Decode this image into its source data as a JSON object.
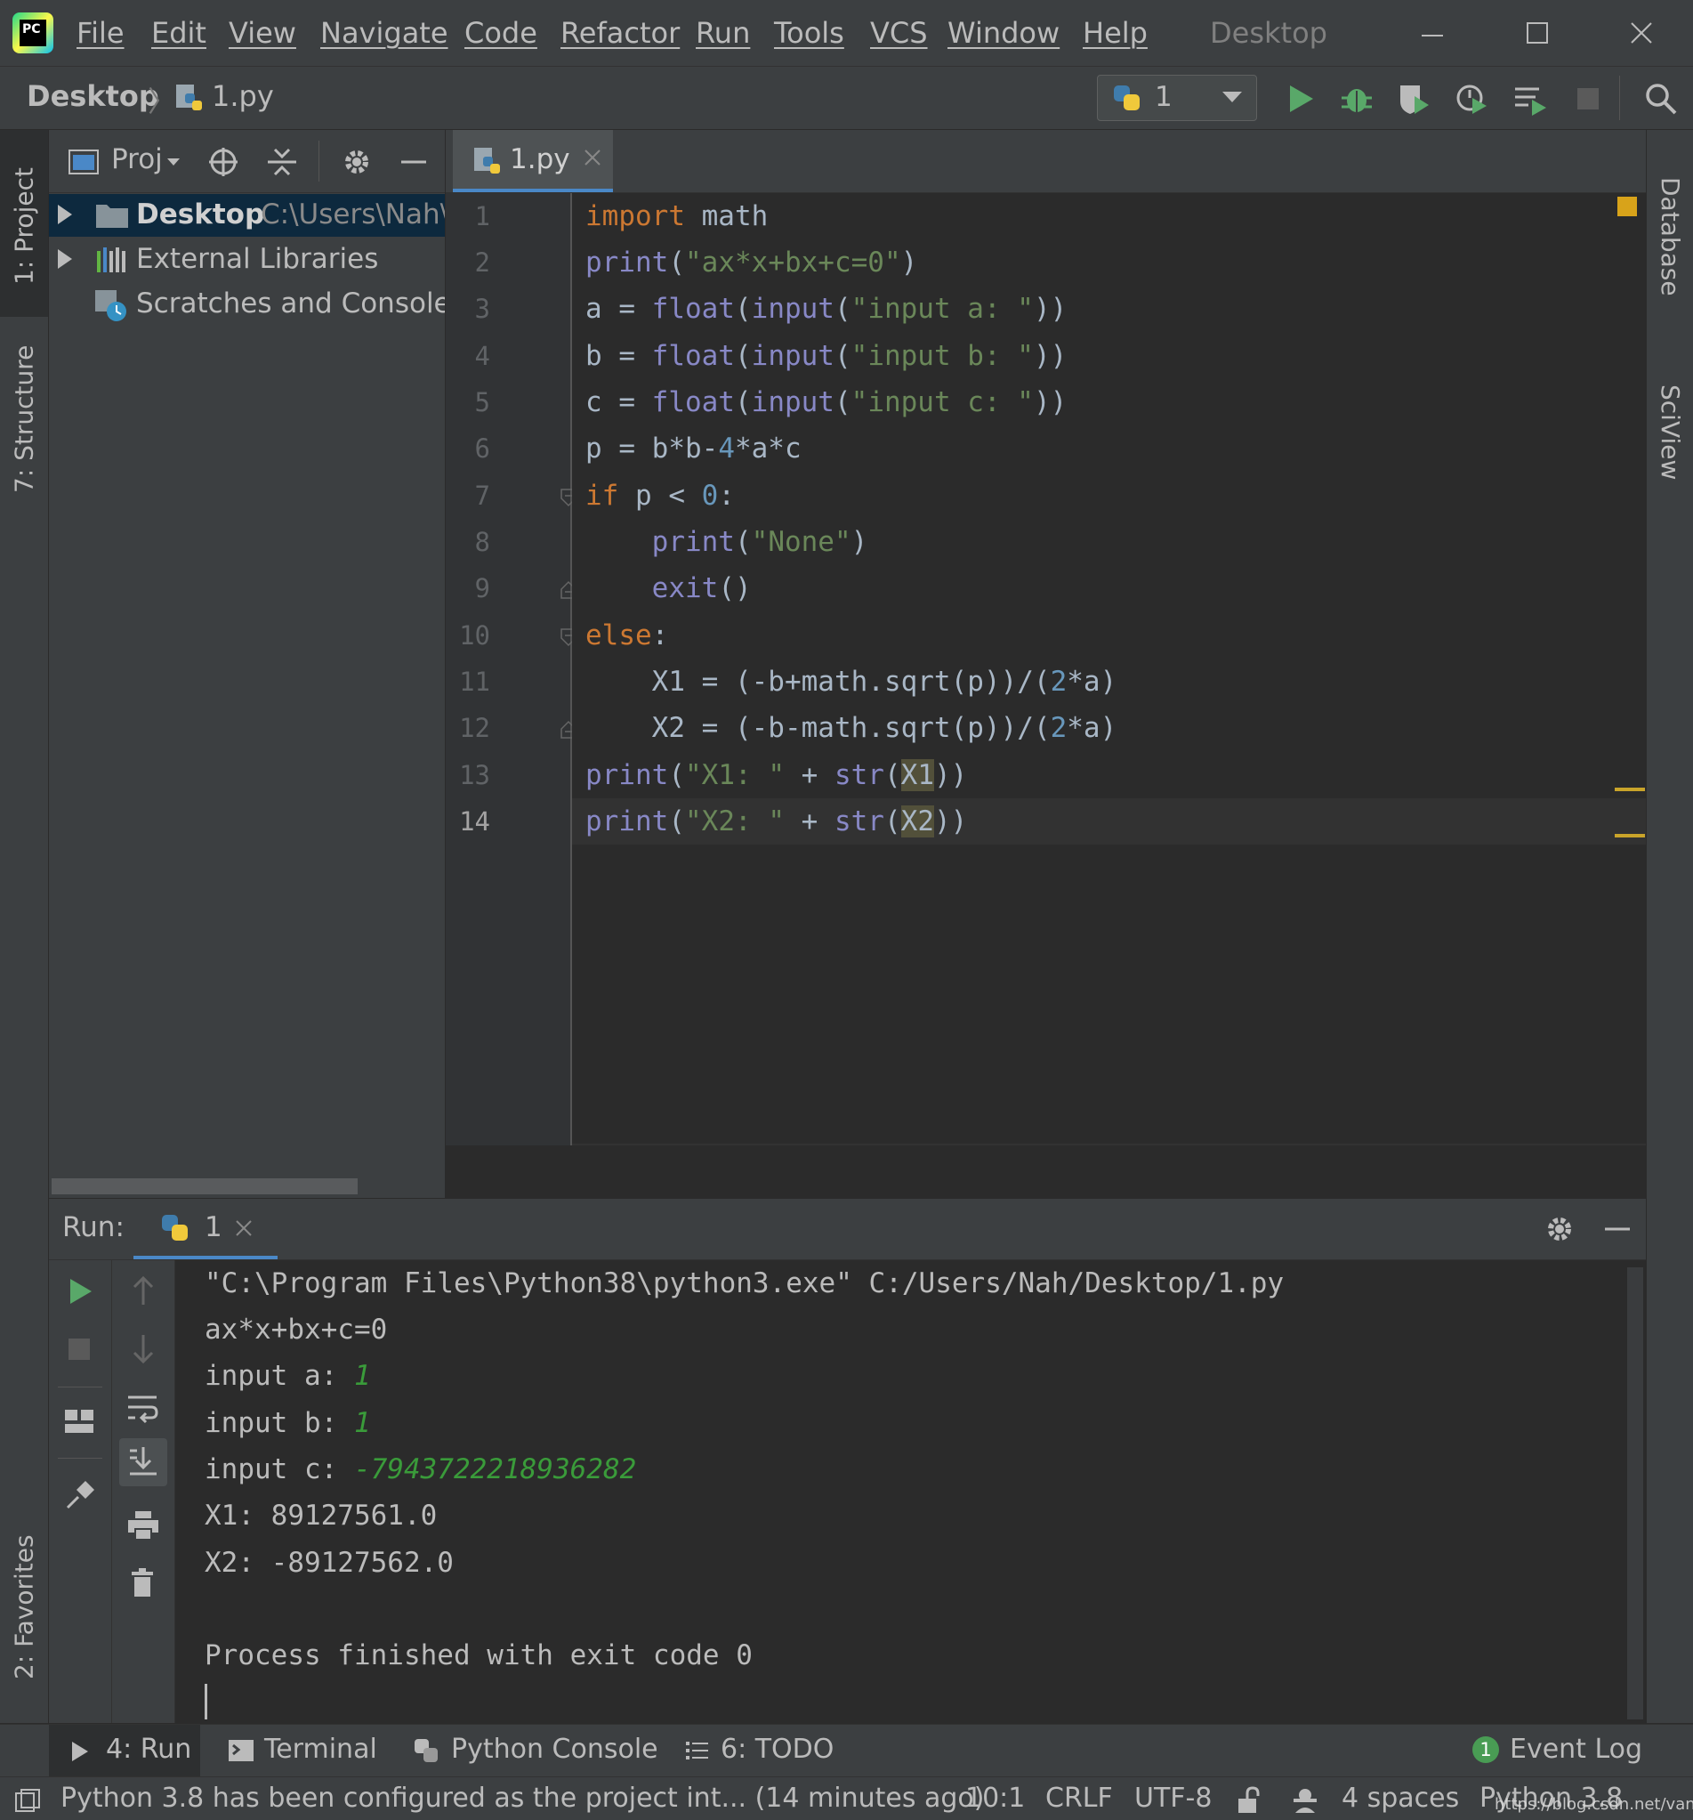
{
  "app": {
    "logo_text": "PC",
    "window_title": "Desktop"
  },
  "menu": [
    "File",
    "Edit",
    "View",
    "Navigate",
    "Code",
    "Refactor",
    "Run",
    "Tools",
    "VCS",
    "Window",
    "Help"
  ],
  "navbar": {
    "project": "Desktop",
    "file": "1.py",
    "run_config": "1"
  },
  "left_strip": {
    "project_tab": "1: Project",
    "structure_tab": "7: Structure",
    "favorites_tab": "2: Favorites"
  },
  "right_strip": {
    "database_tab": "Database",
    "sciview_tab": "SciView"
  },
  "project_panel": {
    "title": "Proj",
    "tree": [
      {
        "label": "Desktop",
        "path": "C:\\Users\\Nah\\D"
      },
      {
        "label": "External Libraries"
      },
      {
        "label": "Scratches and Consoles"
      }
    ]
  },
  "editor": {
    "tab_label": "1.py",
    "line_numbers": [
      "1",
      "2",
      "3",
      "4",
      "5",
      "6",
      "7",
      "8",
      "9",
      "10",
      "11",
      "12",
      "13",
      "14"
    ],
    "current_line": 14
  },
  "run_panel": {
    "label": "Run:",
    "tab_label": "1",
    "output": [
      "\"C:\\Program Files\\Python38\\python3.exe\" C:/Users/Nah/Desktop/1.py",
      "ax*x+bx+c=0",
      {
        "prompt": "input a: ",
        "input": "1"
      },
      {
        "prompt": "input b: ",
        "input": "1"
      },
      {
        "prompt": "input c: ",
        "input": "-7943722218936282"
      },
      "X1: 89127561.0",
      "X2: -89127562.0",
      "",
      "Process finished with exit code 0"
    ]
  },
  "tool_tabs": {
    "run": "4: Run",
    "terminal": "Terminal",
    "python_console": "Python Console",
    "todo": "6: TODO",
    "event_log_count": "1",
    "event_log": "Event Log"
  },
  "status": {
    "message": "Python 3.8 has been configured as the project int... (14 minutes ago)",
    "position": "10:1",
    "line_sep": "CRLF",
    "encoding": "UTF-8",
    "indent": "4 spaces",
    "interpreter": "Python 3.8",
    "watermark": "https://blog.csdn.net/vanarrow"
  },
  "colors": {
    "keyword": "#cc7832",
    "builtin": "#8888c6",
    "string": "#6a8759",
    "number": "#6897bb",
    "user_input": "#3a9b3a",
    "run_green": "#59a869"
  }
}
